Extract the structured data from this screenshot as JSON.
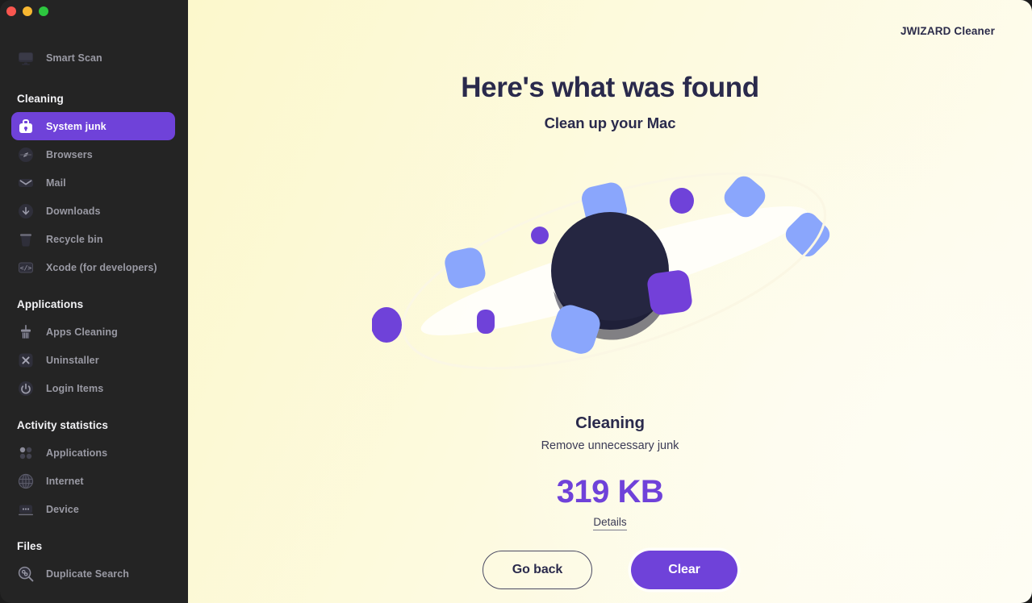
{
  "window": {
    "traffic_lights": [
      {
        "name": "close",
        "color": "#f9564f"
      },
      {
        "name": "minimize",
        "color": "#f7b731"
      },
      {
        "name": "zoom",
        "color": "#2dc73f"
      }
    ]
  },
  "brand": {
    "title": "JWIZARD Cleaner"
  },
  "sidebar": {
    "top_items": [
      {
        "label": "Smart Scan",
        "icon": "monitor-icon",
        "active": false
      }
    ],
    "groups": [
      {
        "title": "Cleaning",
        "items": [
          {
            "label": "System junk",
            "icon": "toolbox-icon",
            "active": true
          },
          {
            "label": "Browsers",
            "icon": "compass-icon",
            "active": false
          },
          {
            "label": "Mail",
            "icon": "envelope-icon",
            "active": false
          },
          {
            "label": "Downloads",
            "icon": "download-arrow-icon",
            "active": false
          },
          {
            "label": "Recycle bin",
            "icon": "trash-icon",
            "active": false
          },
          {
            "label": "Xcode (for developers)",
            "icon": "code-brackets-icon",
            "active": false
          }
        ]
      },
      {
        "title": "Applications",
        "items": [
          {
            "label": "Apps Cleaning",
            "icon": "broom-icon",
            "active": false
          },
          {
            "label": "Uninstaller",
            "icon": "x-square-icon",
            "active": false
          },
          {
            "label": "Login Items",
            "icon": "power-icon",
            "active": false
          }
        ]
      },
      {
        "title": "Activity statistics",
        "items": [
          {
            "label": "Applications",
            "icon": "grid-dots-icon",
            "active": false
          },
          {
            "label": "Internet",
            "icon": "globe-icon",
            "active": false
          },
          {
            "label": "Device",
            "icon": "device-icon",
            "active": false
          }
        ]
      },
      {
        "title": "Files",
        "items": [
          {
            "label": "Duplicate Search",
            "icon": "magnifier-shapes-icon",
            "active": false
          }
        ]
      }
    ]
  },
  "main": {
    "headline": "Here's what was found",
    "subheadline": "Clean up your Mac",
    "illustration": {
      "name": "planet-orbit-illustration",
      "planet_color": "#252641",
      "orbit_color": "#fbf8e8",
      "shape_colors": [
        "#7f9dfb",
        "#6f42d9",
        "#8aa6fc"
      ]
    },
    "result": {
      "title": "Cleaning",
      "subtitle": "Remove unnecessary junk",
      "size": "319 KB",
      "size_color": "#6f42d9",
      "details_label": "Details"
    },
    "buttons": {
      "secondary_label": "Go back",
      "primary_label": "Clear",
      "primary_color": "#6f42d9"
    }
  }
}
